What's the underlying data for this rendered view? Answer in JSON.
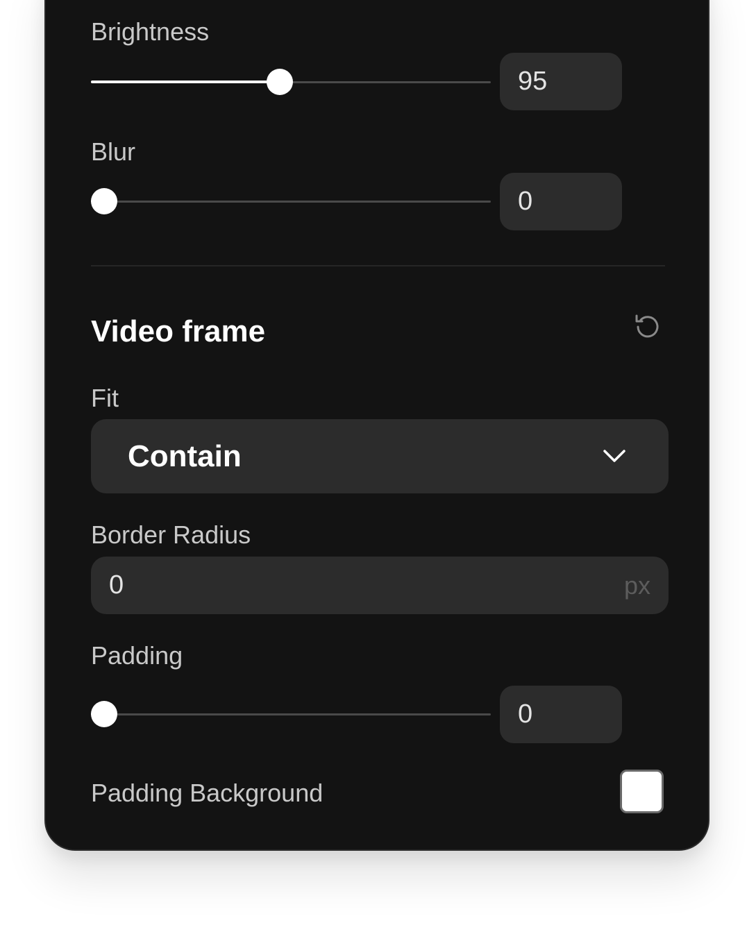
{
  "adjustments": {
    "brightness": {
      "label": "Brightness",
      "value": "95",
      "fraction": 0.47
    },
    "blur": {
      "label": "Blur",
      "value": "0",
      "fraction": 0.0
    }
  },
  "video_frame": {
    "title": "Video frame",
    "reset_icon": "reset-rotate-ccw-icon",
    "fit": {
      "label": "Fit",
      "selected": "Contain",
      "chevron_icon": "chevron-down-icon"
    },
    "border_radius": {
      "label": "Border Radius",
      "value": "0",
      "unit": "px"
    },
    "padding": {
      "label": "Padding",
      "value": "0",
      "fraction": 0.0
    },
    "padding_background": {
      "label": "Padding Background",
      "color": "#ffffff"
    }
  },
  "colors": {
    "panel_bg": "#131313",
    "control_bg": "#2c2c2c",
    "accent": "#ffffff"
  }
}
